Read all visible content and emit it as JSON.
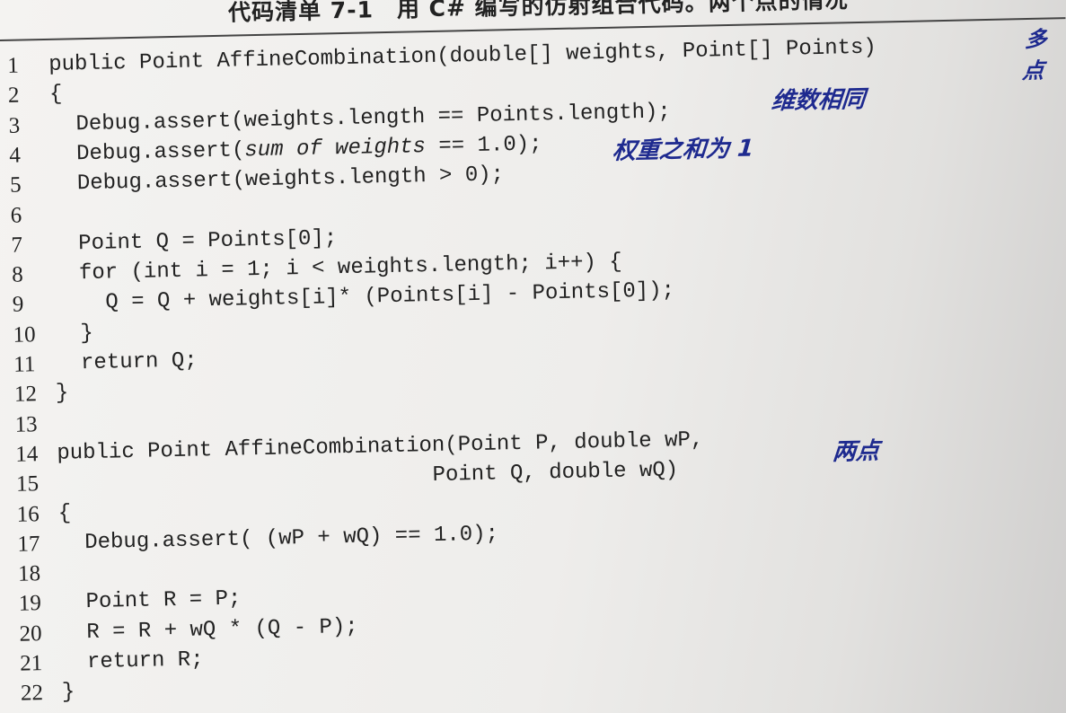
{
  "title": "代码清单 7-1　用 C# 编写的仿射组合代码。两个点的情况",
  "lines": [
    {
      "n": "1",
      "t": "public Point AffineCombination(double[] weights, Point[] Points)"
    },
    {
      "n": "2",
      "t": "{"
    },
    {
      "n": "3",
      "t": "  Debug.assert(weights.length == Points.length);"
    },
    {
      "n": "4",
      "a": "  Debug.assert(",
      "b": "sum of weights",
      "c": " == 1.0);"
    },
    {
      "n": "5",
      "t": "  Debug.assert(weights.length > 0);"
    },
    {
      "n": "6",
      "t": ""
    },
    {
      "n": "7",
      "t": "  Point Q = Points[0];"
    },
    {
      "n": "8",
      "t": "  for (int i = 1; i < weights.length; i++) {"
    },
    {
      "n": "9",
      "t": "    Q = Q + weights[i]* (Points[i] - Points[0]);"
    },
    {
      "n": "10",
      "t": "  }"
    },
    {
      "n": "11",
      "t": "  return Q;"
    },
    {
      "n": "12",
      "t": "}"
    },
    {
      "n": "13",
      "t": ""
    },
    {
      "n": "14",
      "t": "public Point AffineCombination(Point P, double wP,"
    },
    {
      "n": "15",
      "t": "                             Point Q, double wQ)"
    },
    {
      "n": "16",
      "t": "{"
    },
    {
      "n": "17",
      "t": "  Debug.assert( (wP + wQ) == 1.0);"
    },
    {
      "n": "18",
      "t": ""
    },
    {
      "n": "19",
      "t": "  Point R = P;"
    },
    {
      "n": "20",
      "t": "  R = R + wQ * (Q - P);"
    },
    {
      "n": "21",
      "t": "  return R;"
    },
    {
      "n": "22",
      "t": "}"
    }
  ],
  "notes": {
    "n1": "多点",
    "n3": "维数相同",
    "n4": "权重之和为 1",
    "n14": "两点"
  }
}
